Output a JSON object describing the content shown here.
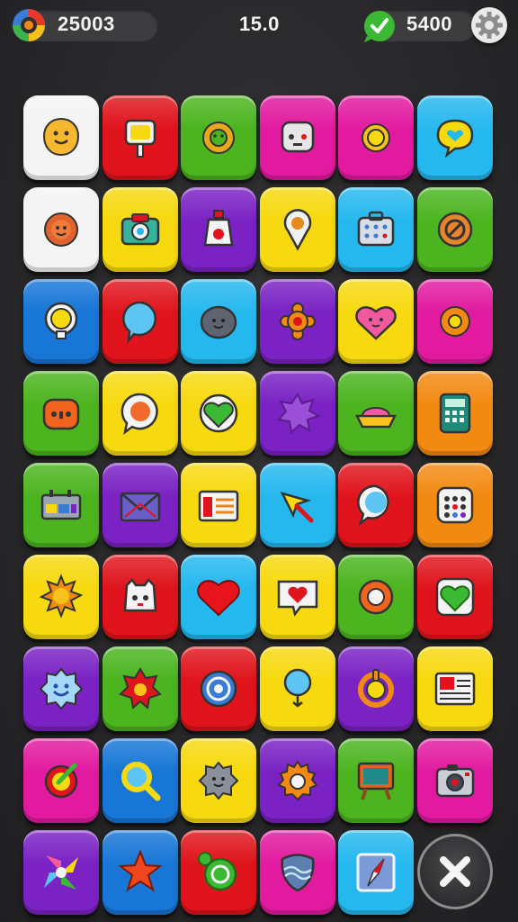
{
  "header": {
    "coins": "25003",
    "center_value": "15.0",
    "gems": "5400"
  },
  "colors": {
    "white": "#f4f4f4",
    "red": "#e0141c",
    "green": "#4cb41f",
    "magenta": "#e21aa0",
    "cyan": "#25b8ee",
    "yellow": "#f7d90f",
    "purple": "#7a22c4",
    "blue": "#1776d6",
    "orange": "#f28a12"
  },
  "tiles": [
    {
      "color": "white",
      "icon": "smiley-blob-icon"
    },
    {
      "color": "red",
      "icon": "signpost-icon"
    },
    {
      "color": "green",
      "icon": "gear-face-icon"
    },
    {
      "color": "magenta",
      "icon": "robot-face-icon"
    },
    {
      "color": "magenta",
      "icon": "sun-gear-icon"
    },
    {
      "color": "cyan",
      "icon": "chat-heart-icon"
    },
    {
      "color": "white",
      "icon": "sun-face-icon"
    },
    {
      "color": "yellow",
      "icon": "camera-icon"
    },
    {
      "color": "purple",
      "icon": "potion-bottle-icon"
    },
    {
      "color": "yellow",
      "icon": "map-pin-icon"
    },
    {
      "color": "cyan",
      "icon": "calculator-bag-icon"
    },
    {
      "color": "green",
      "icon": "no-sign-icon"
    },
    {
      "color": "blue",
      "icon": "lightbulb-icon"
    },
    {
      "color": "red",
      "icon": "speech-bubble-icon"
    },
    {
      "color": "cyan",
      "icon": "rock-face-icon"
    },
    {
      "color": "purple",
      "icon": "orange-flower-icon"
    },
    {
      "color": "yellow",
      "icon": "heart-face-icon"
    },
    {
      "color": "magenta",
      "icon": "gear-icon"
    },
    {
      "color": "green",
      "icon": "orange-monster-icon"
    },
    {
      "color": "yellow",
      "icon": "chat-orb-icon"
    },
    {
      "color": "yellow",
      "icon": "green-heart-icon"
    },
    {
      "color": "purple",
      "icon": "purple-splat-icon"
    },
    {
      "color": "green",
      "icon": "cake-bowl-icon"
    },
    {
      "color": "orange",
      "icon": "calculator-icon"
    },
    {
      "color": "green",
      "icon": "machine-icon"
    },
    {
      "color": "purple",
      "icon": "envelope-icon"
    },
    {
      "color": "yellow",
      "icon": "tv-icon"
    },
    {
      "color": "cyan",
      "icon": "pin-arrow-icon"
    },
    {
      "color": "red",
      "icon": "blue-speech-icon"
    },
    {
      "color": "orange",
      "icon": "dice-icon"
    },
    {
      "color": "yellow",
      "icon": "sun-icon"
    },
    {
      "color": "red",
      "icon": "cute-bot-icon"
    },
    {
      "color": "cyan",
      "icon": "heart-icon"
    },
    {
      "color": "yellow",
      "icon": "heart-card-icon"
    },
    {
      "color": "green",
      "icon": "ring-gear-icon"
    },
    {
      "color": "red",
      "icon": "green-heart-badge-icon"
    },
    {
      "color": "purple",
      "icon": "smile-cloud-icon"
    },
    {
      "color": "green",
      "icon": "red-flower-icon"
    },
    {
      "color": "red",
      "icon": "target-icon"
    },
    {
      "color": "yellow",
      "icon": "balloon-pin-icon"
    },
    {
      "color": "purple",
      "icon": "power-ring-icon"
    },
    {
      "color": "yellow",
      "icon": "newspaper-icon"
    },
    {
      "color": "magenta",
      "icon": "check-ring-icon"
    },
    {
      "color": "blue",
      "icon": "magnifier-icon"
    },
    {
      "color": "yellow",
      "icon": "grey-cloud-icon"
    },
    {
      "color": "purple",
      "icon": "orange-gear-icon"
    },
    {
      "color": "green",
      "icon": "easel-icon"
    },
    {
      "color": "magenta",
      "icon": "photo-camera-icon"
    },
    {
      "color": "purple",
      "icon": "pinwheel-icon"
    },
    {
      "color": "blue",
      "icon": "star-icon"
    },
    {
      "color": "red",
      "icon": "green-swirl-icon"
    },
    {
      "color": "magenta",
      "icon": "wave-shield-icon"
    },
    {
      "color": "cyan",
      "icon": "compass-card-icon"
    }
  ],
  "close_button": {
    "icon": "close-icon"
  }
}
